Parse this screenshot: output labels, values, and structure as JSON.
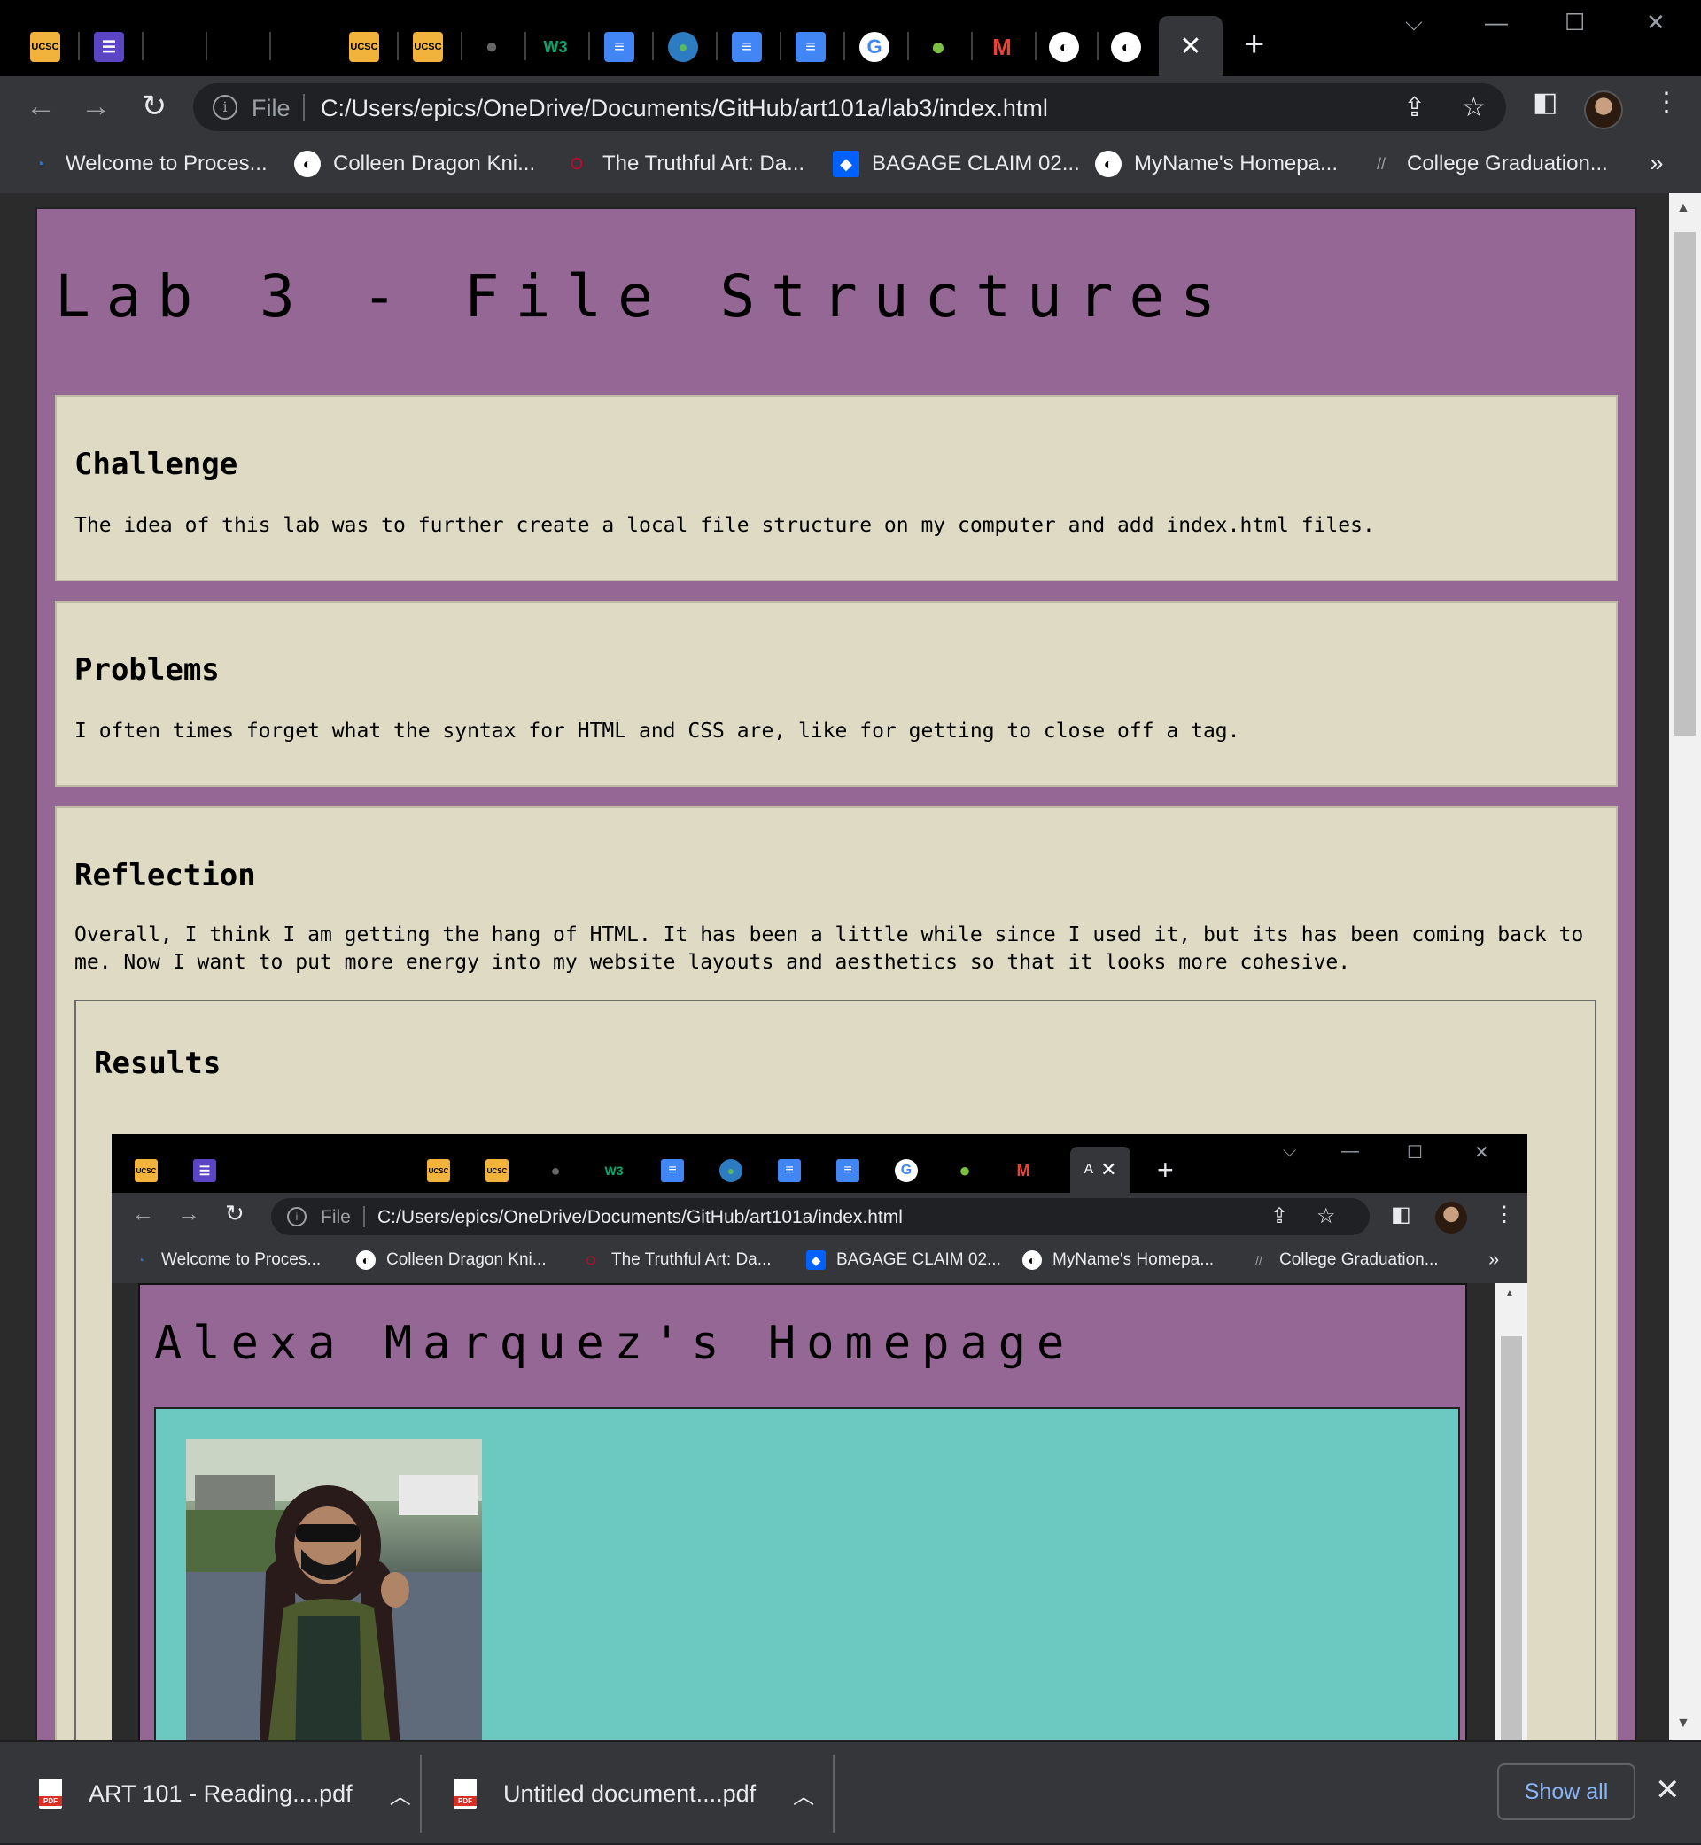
{
  "browser": {
    "tabs": [
      {
        "icon": "ucsc-icon",
        "label": "UCSC"
      },
      {
        "icon": "list-icon",
        "label": ""
      },
      {
        "icon": "blank-icon",
        "label": ""
      },
      {
        "icon": "blank-icon",
        "label": ""
      },
      {
        "icon": "blank-icon",
        "label": ""
      },
      {
        "icon": "ucsc-icon",
        "label": "UCSC"
      },
      {
        "icon": "ucsc-icon",
        "label": "UCSC"
      },
      {
        "icon": "github-icon",
        "label": ""
      },
      {
        "icon": "w3schools-icon",
        "label": "W3"
      },
      {
        "icon": "docs-icon",
        "label": ""
      },
      {
        "icon": "globe-earth-icon",
        "label": ""
      },
      {
        "icon": "docs-icon",
        "label": ""
      },
      {
        "icon": "docs-icon",
        "label": ""
      },
      {
        "icon": "google-icon",
        "label": "G"
      },
      {
        "icon": "leaf-icon",
        "label": ""
      },
      {
        "icon": "gmail-icon",
        "label": "M"
      },
      {
        "icon": "globe-icon",
        "label": ""
      },
      {
        "icon": "globe-icon",
        "label": ""
      }
    ],
    "address": {
      "scheme_label": "File",
      "url": "C:/Users/epics/OneDrive/Documents/GitHub/art101a/lab3/index.html"
    },
    "bookmarks": [
      {
        "label": "Welcome to Proces...",
        "icon": "processing-icon"
      },
      {
        "label": "Colleen Dragon Kni...",
        "icon": "globe-icon"
      },
      {
        "label": "The Truthful Art: Da...",
        "icon": "oreilly-icon"
      },
      {
        "label": "BAGAGE CLAIM 02...",
        "icon": "dropbox-icon"
      },
      {
        "label": "MyName's Homepa...",
        "icon": "globe-icon"
      },
      {
        "label": "College Graduation...",
        "icon": "feather-icon"
      }
    ],
    "bookmarks_more": "»"
  },
  "page": {
    "title": "Lab 3 - File Structures",
    "sections": {
      "challenge": {
        "heading": "Challenge",
        "body": "The idea of this lab was to further create a local file structure on my computer and add index.html files."
      },
      "problems": {
        "heading": "Problems",
        "body": "I often times forget what the syntax for HTML and CSS are, like for getting to close off a tag."
      },
      "reflection": {
        "heading": "Reflection",
        "body": "Overall, I think I am getting the hang of HTML. It has been a little while since I used it, but its has been coming back to me. Now I want to put more energy into my website layouts and aesthetics so that it looks more cohesive."
      },
      "results": {
        "heading": "Results"
      }
    }
  },
  "screenshot": {
    "address": {
      "scheme_label": "File",
      "url": "C:/Users/epics/OneDrive/Documents/GitHub/art101a/index.html"
    },
    "active_tab_label": "A",
    "bookmarks": [
      {
        "label": "Welcome to Proces..."
      },
      {
        "label": "Colleen Dragon Kni..."
      },
      {
        "label": "The Truthful Art: Da..."
      },
      {
        "label": "BAGAGE CLAIM 02..."
      },
      {
        "label": "MyName's Homepa..."
      },
      {
        "label": "College Graduation..."
      }
    ],
    "bookmarks_more": "»",
    "page_title": "Alexa Marquez's Homepage"
  },
  "downloads": {
    "items": [
      {
        "filename": "ART 101 - Reading....pdf"
      },
      {
        "filename": "Untitled document....pdf"
      }
    ],
    "show_all": "Show all"
  },
  "colors": {
    "page_purple": "#956794",
    "card_beige": "#dedac4",
    "teal": "#6cc9c1",
    "link_blue": "#8ab4f8"
  }
}
